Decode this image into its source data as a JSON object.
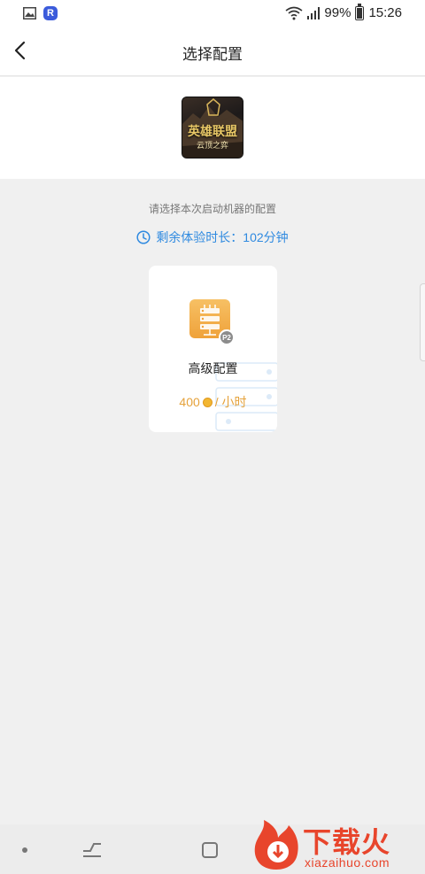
{
  "status_bar": {
    "battery_percent": "99%",
    "time": "15:26",
    "app_badge": "R"
  },
  "header": {
    "title": "选择配置"
  },
  "game": {
    "logo_title": "英雄联盟",
    "logo_subtitle": "云顶之弈"
  },
  "content": {
    "hint": "请选择本次启动机器的配置",
    "remaining_time": "剩余体验时长：102分钟"
  },
  "config_card": {
    "badge": "P2",
    "name": "高级配置",
    "price": "400",
    "unit": "/ 小时"
  },
  "watermark": {
    "brand_cn": "下载火",
    "brand_en": "xiazaihuo.com"
  },
  "colors": {
    "accent_blue": "#2f8ae0",
    "price_orange": "#e5a23b",
    "icon_orange": "#f2a93e",
    "brand_red": "#e8452c"
  }
}
